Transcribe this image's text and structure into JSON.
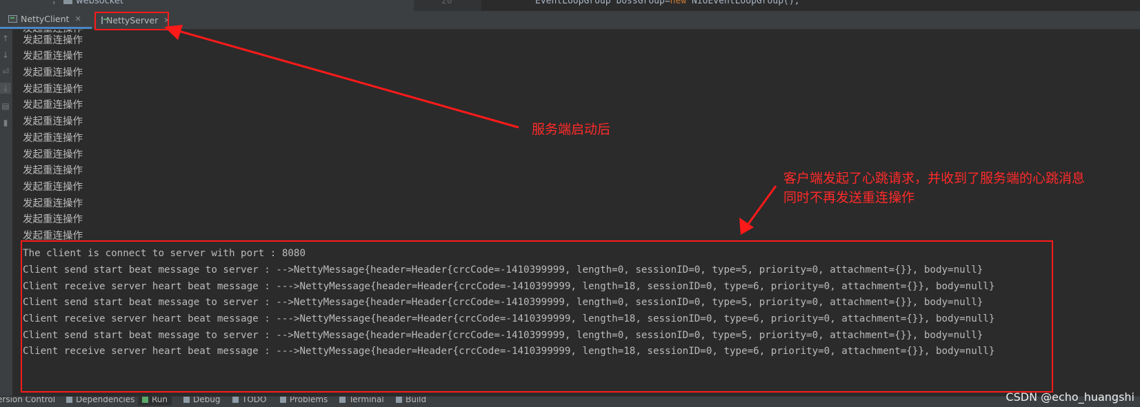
{
  "top_strip": {
    "project_item": "websocket",
    "line_number": "20",
    "code_prefix": "EventLoopGroup bossGroup=",
    "code_keyword": "new",
    "code_suffix": " NioEventLoopGroup();"
  },
  "tabs": [
    {
      "label": "NettyClient",
      "active": true
    },
    {
      "label": "NettyServer",
      "active": false
    }
  ],
  "left_toolbar": [
    "arrow-up-icon",
    "arrow-down-icon",
    "soft-wrap-icon",
    "scroll-to-end-icon",
    "print-icon",
    "trash-icon"
  ],
  "console": {
    "reconnect_lines": [
      "发起重连操作",
      "发起重连操作",
      "发起重连操作",
      "发起重连操作",
      "发起重连操作",
      "发起重连操作",
      "发起重连操作",
      "发起重连操作",
      "发起重连操作",
      "发起重连操作",
      "发起重连操作",
      "发起重连操作",
      "发起重连操作"
    ],
    "log_lines": [
      "The client is connect to server with port : 8080",
      "Client send start beat message to server : -->NettyMessage{header=Header{crcCode=-1410399999, length=0, sessionID=0, type=5, priority=0, attachment={}}, body=null}",
      "Client receive server heart beat message : --->NettyMessage{header=Header{crcCode=-1410399999, length=18, sessionID=0, type=6, priority=0, attachment={}}, body=null}",
      "Client send start beat message to server : -->NettyMessage{header=Header{crcCode=-1410399999, length=0, sessionID=0, type=5, priority=0, attachment={}}, body=null}",
      "Client receive server heart beat message : --->NettyMessage{header=Header{crcCode=-1410399999, length=18, sessionID=0, type=6, priority=0, attachment={}}, body=null}",
      "Client send start beat message to server : -->NettyMessage{header=Header{crcCode=-1410399999, length=0, sessionID=0, type=5, priority=0, attachment={}}, body=null}",
      "Client receive server heart beat message : --->NettyMessage{header=Header{crcCode=-1410399999, length=18, sessionID=0, type=6, priority=0, attachment={}}, body=null}"
    ]
  },
  "bottom_bar": [
    {
      "label": "ersion Control",
      "icon": "version-control-icon"
    },
    {
      "label": "Dependencies",
      "icon": "dependencies-icon"
    },
    {
      "label": "Run",
      "icon": "run-icon"
    },
    {
      "label": "Debug",
      "icon": "debug-icon"
    },
    {
      "label": "TODO",
      "icon": "todo-icon"
    },
    {
      "label": "Problems",
      "icon": "problems-icon"
    },
    {
      "label": "Terminal",
      "icon": "terminal-icon"
    },
    {
      "label": "Build",
      "icon": "build-icon"
    }
  ],
  "annotations": {
    "server_started": "服务端启动后",
    "heartbeat_line1": "客户端发起了心跳请求，并收到了服务端的心跳消息",
    "heartbeat_line2": "同时不再发送重连操作",
    "color": "#ff1a1a"
  },
  "watermark": "CSDN @echo_huangshi",
  "colors": {
    "console_bg": "#2b2b2b",
    "console_text": "#bbbbbb",
    "toolbar_bg": "#3c3f41",
    "active_tab_underline": "#4a88c7"
  }
}
